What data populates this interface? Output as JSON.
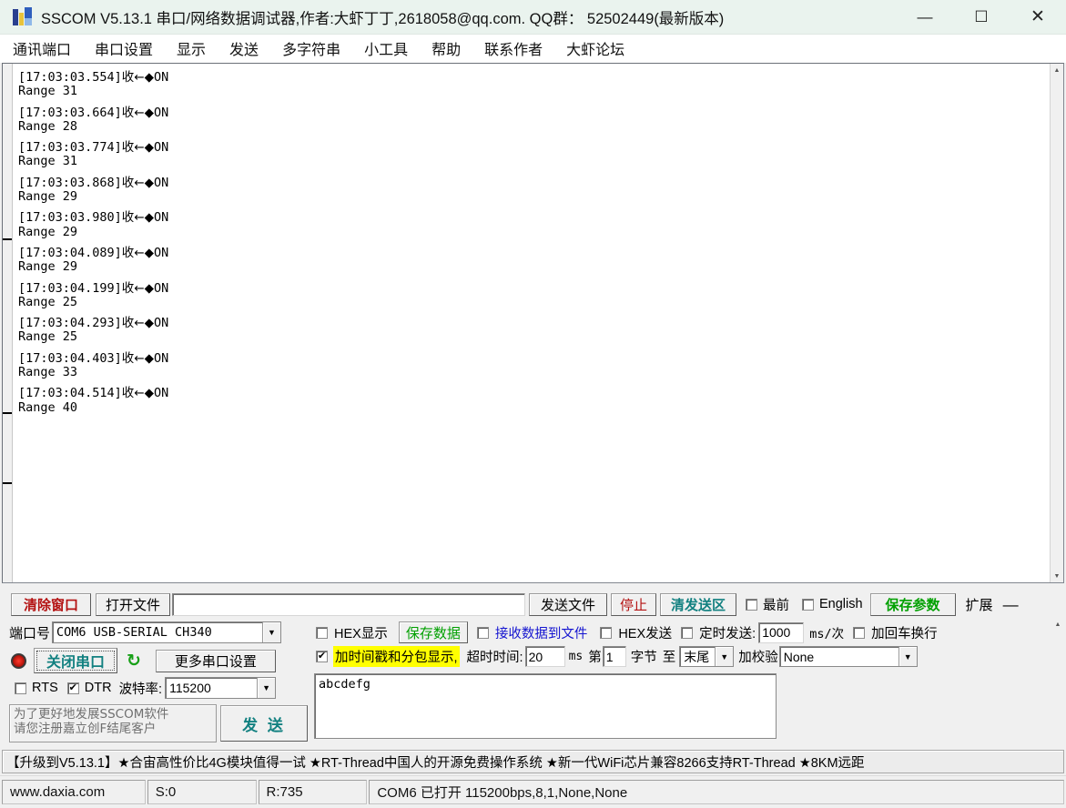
{
  "window": {
    "title": "SSCOM V5.13.1 串口/网络数据调试器,作者:大虾丁丁,2618058@qq.com. QQ群： 52502449(最新版本)",
    "minimize": "—",
    "maximize": "☐",
    "close": "✕"
  },
  "menu": {
    "items": [
      {
        "label": "通讯端口"
      },
      {
        "label": "串口设置"
      },
      {
        "label": "显示"
      },
      {
        "label": "发送"
      },
      {
        "label": "多字符串"
      },
      {
        "label": "小工具"
      },
      {
        "label": "帮助"
      },
      {
        "label": "联系作者"
      },
      {
        "label": "大虾论坛"
      }
    ]
  },
  "terminal": {
    "recv_prefix": "收←◆",
    "lines": [
      {
        "ts": "[17:03:03.554]",
        "marker": "收←◆",
        "payload": "ON",
        "range": "Range 31"
      },
      {
        "ts": "[17:03:03.664]",
        "marker": "收←◆",
        "payload": "ON",
        "range": "Range 28"
      },
      {
        "ts": "[17:03:03.774]",
        "marker": "收←◆",
        "payload": "ON",
        "range": "Range 31"
      },
      {
        "ts": "[17:03:03.868]",
        "marker": "收←◆",
        "payload": "ON",
        "range": "Range 29"
      },
      {
        "ts": "[17:03:03.980]",
        "marker": "收←◆",
        "payload": "ON",
        "range": "Range 29"
      },
      {
        "ts": "[17:03:04.089]",
        "marker": "收←◆",
        "payload": "ON",
        "range": "Range 29"
      },
      {
        "ts": "[17:03:04.199]",
        "marker": "收←◆",
        "payload": "ON",
        "range": "Range 25"
      },
      {
        "ts": "[17:03:04.293]",
        "marker": "收←◆",
        "payload": "ON",
        "range": "Range 25"
      },
      {
        "ts": "[17:03:04.403]",
        "marker": "收←◆",
        "payload": "ON",
        "range": "Range 33"
      },
      {
        "ts": "[17:03:04.514]",
        "marker": "收←◆",
        "payload": "ON",
        "range": "Range 40"
      }
    ],
    "scroll_up": "▲",
    "scroll_down": "▼"
  },
  "toolbar": {
    "clear_window": "清除窗口",
    "open_file": "打开文件",
    "file_path": "",
    "file_path_placeholder": "",
    "send_file": "发送文件",
    "stop": "停止",
    "clear_send": "清发送区",
    "topmost_label": "最前",
    "topmost_checked": false,
    "english_label": "English",
    "english_checked": false,
    "save_params": "保存参数",
    "extend": "扩展",
    "collapse": "—"
  },
  "serial": {
    "port_label": "端口号",
    "port_value": "COM6 USB-SERIAL CH340",
    "close_port_button": "关闭串口",
    "refresh_icon": "↻",
    "more_settings": "更多串口设置",
    "rts_label": "RTS",
    "rts_checked": false,
    "dtr_label": "DTR",
    "dtr_checked": true,
    "baud_label": "波特率:",
    "baud_value": "115200",
    "register_line1": "为了更好地发展SSCOM软件",
    "register_line2": "请您注册嘉立创F结尾客户",
    "send_button": "发 送"
  },
  "recv_options": {
    "hex_display_label": "HEX显示",
    "hex_display_checked": false,
    "save_data_button": "保存数据",
    "recv_to_file_label": "接收数据到文件",
    "recv_to_file_checked": false,
    "timestamp_label": "加时间戳和分包显示,",
    "timestamp_checked": true,
    "timeout_label": "超时时间:",
    "timeout_value": "20",
    "timeout_unit": "ms"
  },
  "send_options": {
    "hex_send_label": "HEX发送",
    "hex_send_checked": false,
    "timed_send_label": "定时发送:",
    "timed_send_checked": false,
    "timed_send_value": "1000",
    "timed_send_unit": "ms/次",
    "crlf_label": "加回车换行",
    "crlf_checked": false,
    "help_icon": "?",
    "byte_from_label": "第",
    "byte_from_value": "1",
    "byte_unit_label": "字节",
    "byte_to_label": "至",
    "byte_to_value": "末尾",
    "checksum_label": "加校验",
    "checksum_value": "None",
    "send_text": "abcdefg"
  },
  "ad_bar": {
    "text": "【升级到V5.13.1】★合宙高性价比4G模块值得一试 ★RT-Thread中国人的开源免费操作系统 ★新一代WiFi芯片兼容8266支持RT-Thread ★8KM远距"
  },
  "status_bar": {
    "website": "www.daxia.com",
    "sent": "S:0",
    "received": "R:735",
    "connection": "COM6 已打开  115200bps,8,1,None,None"
  },
  "colors": {
    "accent_red": "#b41212",
    "accent_teal": "#128080",
    "accent_green": "#00a000",
    "accent_blue": "#1414d0",
    "highlight_yellow": "#ffff00",
    "title_bg": "#eaf3ee"
  }
}
